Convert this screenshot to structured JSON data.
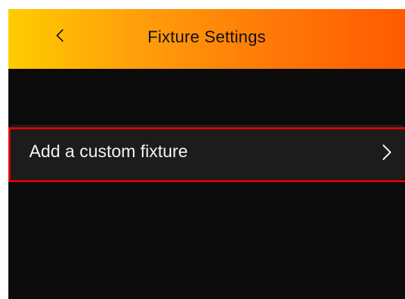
{
  "header": {
    "title": "Fixture Settings",
    "back_icon": "chevron-left-icon"
  },
  "list": {
    "items": [
      {
        "label": "Add a custom fixture",
        "icon": "chevron-right-icon"
      }
    ]
  },
  "colors": {
    "header_gradient_start": "#ffcc00",
    "header_gradient_end": "#ff5a00",
    "background": "#0b0b0b",
    "list_item_background": "#1c1c1c",
    "highlight_border": "#e00000"
  }
}
